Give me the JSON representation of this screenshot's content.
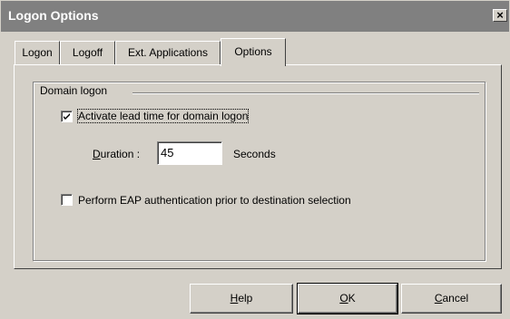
{
  "window": {
    "title": "Logon Options",
    "close_glyph": "×"
  },
  "tabs": [
    {
      "label": "Logon"
    },
    {
      "label": "Logoff"
    },
    {
      "label": "Ext. Applications"
    },
    {
      "label": "Options",
      "active": true
    }
  ],
  "domain_logon": {
    "group_title": "Domain logon",
    "lead_time_checkbox": {
      "label": "Activate lead time for domain logon",
      "checked": true
    },
    "duration": {
      "label": "Duration :",
      "value": "45",
      "unit": "Seconds"
    },
    "eap_checkbox": {
      "label": "Perform EAP authentication prior to destination selection",
      "checked": false
    }
  },
  "buttons": {
    "help": "Help",
    "ok": "OK",
    "cancel": "Cancel"
  },
  "icons": {
    "close": "close-icon",
    "check": "checkmark-icon"
  },
  "colors": {
    "face": "#d4d0c8",
    "titlebar": "#808080"
  }
}
